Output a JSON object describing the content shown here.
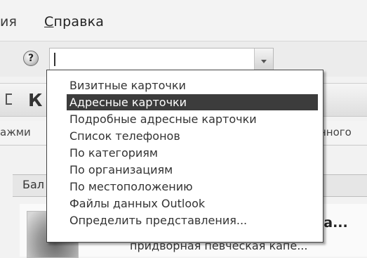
{
  "menubar": {
    "items": [
      {
        "label": "ия"
      },
      {
        "mnemonic": "С",
        "rest": "правка"
      }
    ]
  },
  "toolbar": {
    "help_icon": "question-circle-icon",
    "help_glyph": "?",
    "view_combo": {
      "value": "",
      "dropdown_icon": "chevron-down-icon"
    }
  },
  "pane": {
    "title_fragment": "К",
    "hint_left": "ажми",
    "hint_right": "нного",
    "tab_label": "Бал",
    "contact_name_fragment": "ба...",
    "contact_sub_fragment": "придворная певческая капе..."
  },
  "view_dropdown": {
    "selected_index": 1,
    "options": [
      "Визитные карточки",
      "Адресные карточки",
      "Подробные адресные карточки",
      "Список телефонов",
      "По категориям",
      "По организациям",
      "По местоположению",
      "Файлы данных Outlook",
      "Определить представления..."
    ]
  }
}
